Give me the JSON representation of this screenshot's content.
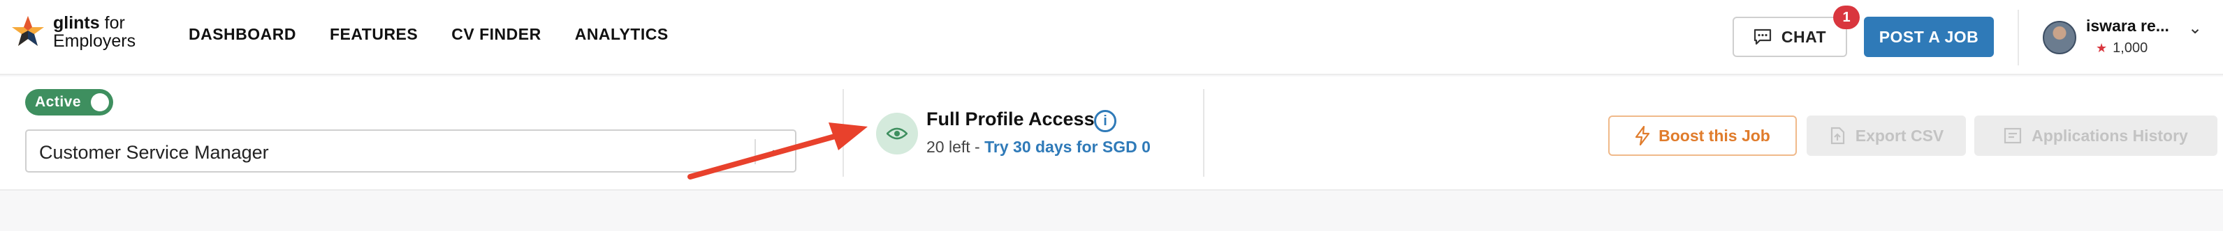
{
  "brand": {
    "name_bold": "glints",
    "name_rest": " for",
    "line2": "Employers"
  },
  "nav": {
    "items": [
      "DASHBOARD",
      "FEATURES",
      "CV FINDER",
      "ANALYTICS"
    ]
  },
  "header": {
    "chat_label": "CHAT",
    "chat_badge": "1",
    "post_job_label": "POST A JOB",
    "user_name": "iswara re...",
    "credits": "1,000"
  },
  "job": {
    "status_label": "Active",
    "selected_job": "Customer Service Manager"
  },
  "profile_access": {
    "title": "Full Profile Access",
    "remaining": "20 left",
    "separator": " - ",
    "trial_link": "Try 30 days for SGD 0"
  },
  "actions": {
    "boost_label": "Boost this Job",
    "export_label": "Export CSV",
    "history_label": "Applications History"
  },
  "colors": {
    "primary": "#2f7ab8",
    "active_green": "#3e8f5f",
    "boost_orange": "#e07c2c",
    "badge_red": "#d9363e",
    "annotation_arrow": "#e8412c"
  },
  "icons": [
    "glints-star-logo",
    "chat-icon",
    "chevron-down-icon",
    "star-icon",
    "eye-icon",
    "info-icon",
    "lightning-icon",
    "export-icon",
    "history-icon",
    "annotation-arrow"
  ]
}
